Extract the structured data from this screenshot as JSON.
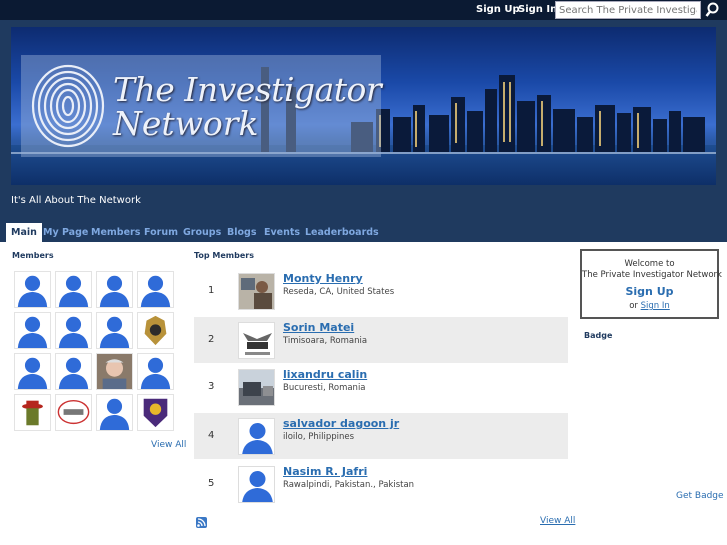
{
  "topbar": {
    "signup": "Sign Up",
    "signin": "Sign In",
    "search_placeholder": "Search The Private Investigator N",
    "search_icon": "search-icon"
  },
  "header": {
    "logo_line1": "The Investigator",
    "logo_line2": "Network",
    "tagline": "It's All About The Network",
    "logo_icon": "fingerprint-icon"
  },
  "nav": {
    "tabs": [
      {
        "label": "Main",
        "active": true
      },
      {
        "label": "My Page"
      },
      {
        "label": "Members"
      },
      {
        "label": "Forum"
      },
      {
        "label": "Groups"
      },
      {
        "label": "Blogs"
      },
      {
        "label": "Events"
      },
      {
        "label": "Leaderboards"
      }
    ]
  },
  "members": {
    "title": "Members",
    "view_all": "View All"
  },
  "top_members": {
    "title": "Top Members",
    "rows": [
      {
        "rank": "1",
        "name": "Monty Henry",
        "location": "Reseda, CA, United States"
      },
      {
        "rank": "2",
        "name": "Sorin Matei",
        "location": "Timisoara, Romania"
      },
      {
        "rank": "3",
        "name": "lixandru calin",
        "location": "Bucuresti, Romania"
      },
      {
        "rank": "4",
        "name": "salvador dagoon jr",
        "location": "iloilo, Philippines"
      },
      {
        "rank": "5",
        "name": "Nasim R. Jafri",
        "location": "Rawalpindi, Pakistan., Pakistan"
      }
    ],
    "view_all": "View All",
    "rss_icon": "rss-icon"
  },
  "sidebar": {
    "welcome_line1": "Welcome to",
    "welcome_line2": "The Private Investigator Network",
    "signup": "Sign Up",
    "or": "or",
    "signin": "Sign In",
    "badge_title": "Badge",
    "get_badge": "Get Badge"
  },
  "colors": {
    "topbar": "#0b1a33",
    "header": "#1f3a5f",
    "link": "#2a6db0",
    "avatar_blue": "#2f6bd8"
  }
}
